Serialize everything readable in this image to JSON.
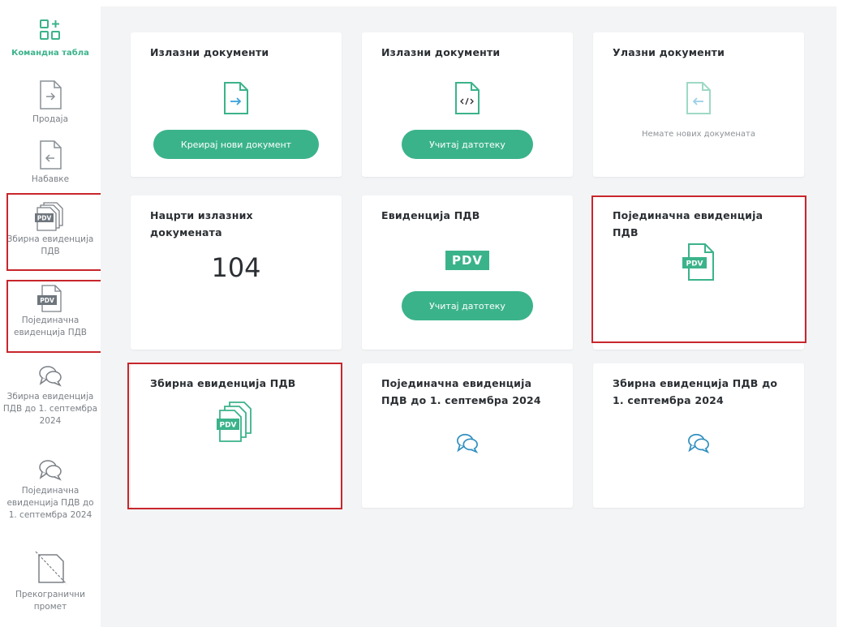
{
  "sidebar": {
    "items": [
      {
        "label": "Командна табла",
        "icon": "dashboard-icon",
        "active": true
      },
      {
        "label": "Продаја",
        "icon": "outgoing-doc-icon"
      },
      {
        "label": "Набавке",
        "icon": "incoming-doc-icon"
      },
      {
        "label": "Збирна евиденција ПДВ",
        "icon": "pdv-stack-icon"
      },
      {
        "label": "Појединачна евиденција ПДВ",
        "icon": "pdv-doc-icon"
      },
      {
        "label": "Збирна евиденција ПДВ до 1. септембра 2024",
        "icon": "chat-icon"
      },
      {
        "label": "Појединачна евиденција ПДВ до 1. септембра 2024",
        "icon": "chat-icon"
      },
      {
        "label": "Прекогранични промет",
        "icon": "cross-border-icon"
      }
    ]
  },
  "cards": {
    "outgoing_create": {
      "title": "Излазни документи",
      "button": "Креирај нови документ",
      "icon": "outgoing-doc-icon"
    },
    "outgoing_upload": {
      "title": "Излазни документи",
      "button": "Учитај датотеку",
      "icon": "xml-doc-icon"
    },
    "incoming": {
      "title": "Улазни документи",
      "message": "Немате нових докумената",
      "icon": "incoming-doc-icon"
    },
    "drafts": {
      "title": "Нацрти излазних докумената",
      "count": "104"
    },
    "vat_records": {
      "title": "Евиденција ПДВ",
      "badge": "PDV",
      "button": "Учитај датотеку"
    },
    "individual_vat": {
      "title": "Појединачна евиденција ПДВ",
      "icon": "pdv-doc-icon"
    },
    "summary_vat": {
      "title": "Збирна евиденција ПДВ",
      "icon": "pdv-stack-icon"
    },
    "individual_vat_old": {
      "title": "Појединачна евиденција ПДВ до 1. септембра 2024",
      "icon": "chat-icon"
    },
    "summary_vat_old": {
      "title": "Збирна евиденција ПДВ до 1. септембра 2024",
      "icon": "chat-icon"
    }
  },
  "pdv_icon_text": "PDV",
  "colors": {
    "accent": "#3bb38a",
    "highlight": "#c8262c",
    "background": "#f3f4f6"
  }
}
